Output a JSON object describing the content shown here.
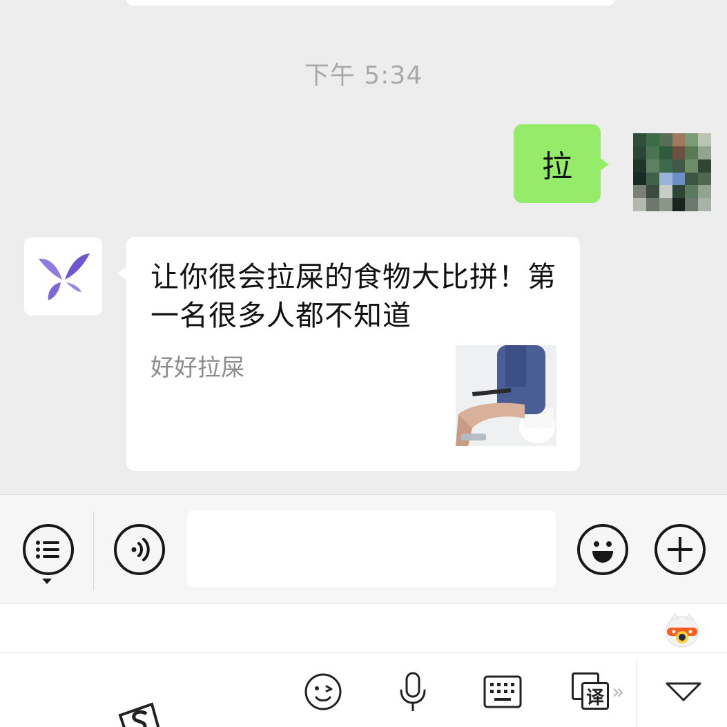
{
  "chat": {
    "timestamp": "下午 5:34",
    "outgoing_message": {
      "text": "拉",
      "bubble_color": "#95ec69"
    },
    "incoming_card": {
      "title": "让你很会拉屎的食物大比拼！第一名很多人都不知道",
      "source": "好好拉屎"
    }
  },
  "icons": {
    "avatar_self": "pixelated-avatar",
    "avatar_sender": "butterfly-icon",
    "menu": "list-menu-icon",
    "voice": "voice-icon",
    "emoji": "smile-icon",
    "more": "plus-icon",
    "kb_emoji": "wink-face-icon",
    "kb_mic": "microphone-icon",
    "kb_keyboard": "keyboard-icon",
    "kb_translate": "translate-icon",
    "kb_collapse": "collapse-down-icon"
  },
  "keyboard": {
    "translate_label": "译",
    "more_chevrons": "»"
  },
  "colors": {
    "chat_background": "#ededed",
    "accent_purple": "#7b5cd6"
  }
}
